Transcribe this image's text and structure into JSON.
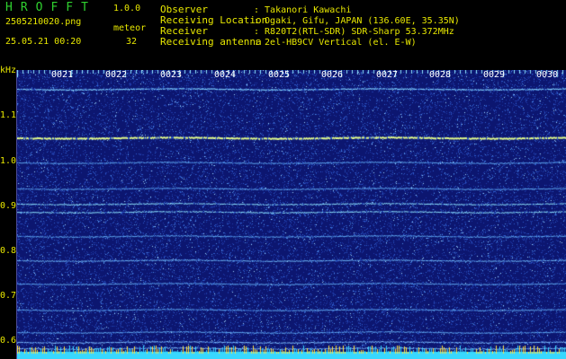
{
  "header": {
    "app_title": "HROFFT",
    "app_version": "1.0.0",
    "file_name": "2505210020.png",
    "meteor_label": "meteor",
    "datetime": "25.05.21 00:20",
    "meteor_count": "32",
    "info": [
      {
        "key": "Observer",
        "value": ": Takanori Kawachi"
      },
      {
        "key": "Receiving Location",
        "value": ": Ogaki, Gifu, JAPAN (136.60E, 35.35N)"
      },
      {
        "key": "Receiver",
        "value": ": R820T2(RTL-SDR) SDR-Sharp 53.372MHz"
      },
      {
        "key": "Receiving antenna",
        "value": ": 2el-HB9CV Vertical (el. E-W)"
      }
    ]
  },
  "spectrogram": {
    "y_unit": "kHz",
    "y_ticks": [
      "1.1",
      "1.0",
      "0.9",
      "0.8",
      "0.7",
      "0.6"
    ],
    "x_ticks": [
      "0021",
      "0022",
      "0023",
      "0024",
      "0025",
      "0026",
      "0027",
      "0028",
      "0029",
      "0030"
    ],
    "colors": {
      "background": "#0c1670",
      "strong_line": "#e6ff8a",
      "line": "#8fe6ff",
      "label": "#e8e800",
      "bottom_band": "#38d8ff"
    }
  }
}
